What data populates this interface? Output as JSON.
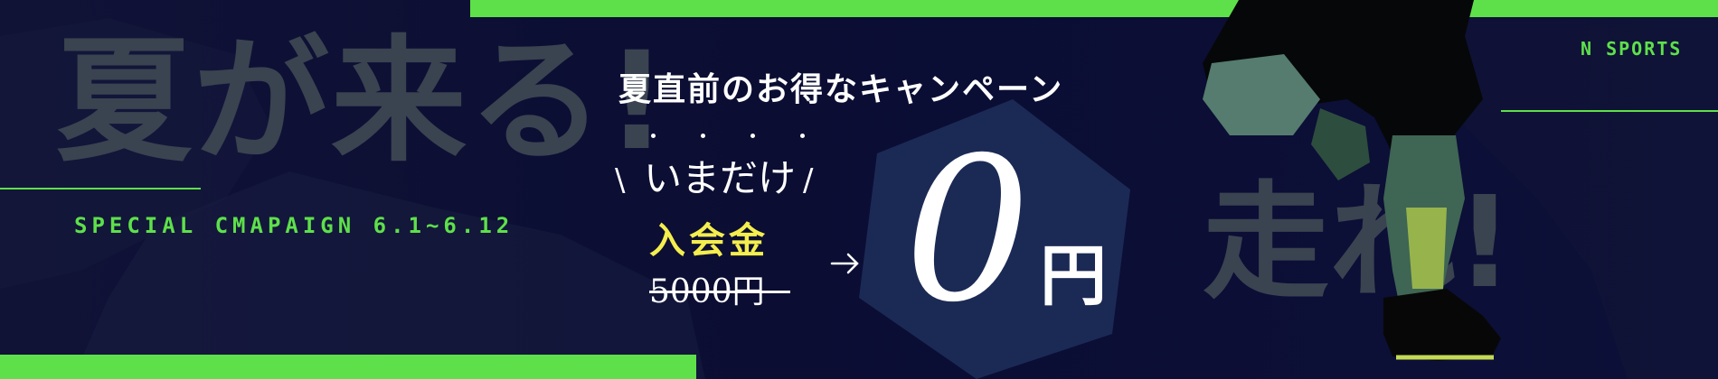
{
  "banner": {
    "ghost_left": "夏が来る!",
    "ghost_right": "走れ!",
    "special_text": "SPECIAL CMAPAIGN 6.1~6.12",
    "headline": "夏直前のお得なキャンペーン",
    "now_only": "いまだけ",
    "slash_left": "\\",
    "slash_right": "/",
    "fee_label": "入会金",
    "old_price": "5000円",
    "new_price_number": "0",
    "new_price_unit": "円",
    "brand": "N SPORTS"
  },
  "icons": {
    "arrow": "arrow-right-icon",
    "emphasis_dots": "emphasis-dots-icon",
    "hexagon": "hexagon-shape",
    "runner": "runner-silhouette"
  },
  "colors": {
    "accent_green": "#5ee04a",
    "background_navy": "#0b0d33",
    "hexagon_blue": "#1b2a55",
    "highlight_yellow": "#f4ee4e"
  }
}
